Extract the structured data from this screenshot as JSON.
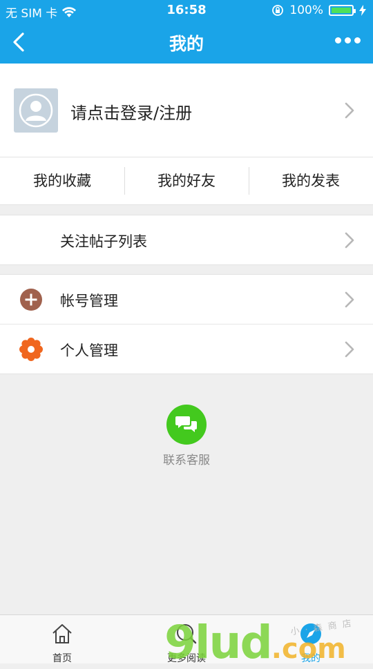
{
  "status": {
    "carrier": "无 SIM 卡",
    "time": "16:58",
    "battery": "100%"
  },
  "nav": {
    "title": "我的"
  },
  "profile": {
    "login_prompt": "请点击登录/注册"
  },
  "shortcuts": [
    {
      "label": "我的收藏"
    },
    {
      "label": "我的好友"
    },
    {
      "label": "我的发表"
    }
  ],
  "rows": {
    "follow": {
      "label": "关注帖子列表"
    },
    "account": {
      "label": "帐号管理"
    },
    "personal": {
      "label": "个人管理"
    }
  },
  "service": {
    "label": "联系客服"
  },
  "tabs": [
    {
      "label": "首页"
    },
    {
      "label": "更多阅读"
    },
    {
      "label": "我的"
    }
  ],
  "watermark": {
    "brand": "9lud",
    "tld": ".com",
    "small": "小 · 森 商 店"
  },
  "colors": {
    "primary": "#1aa4e8",
    "account_icon": "#a0614d",
    "personal_icon": "#f0661e",
    "service_icon": "#43c91e"
  }
}
